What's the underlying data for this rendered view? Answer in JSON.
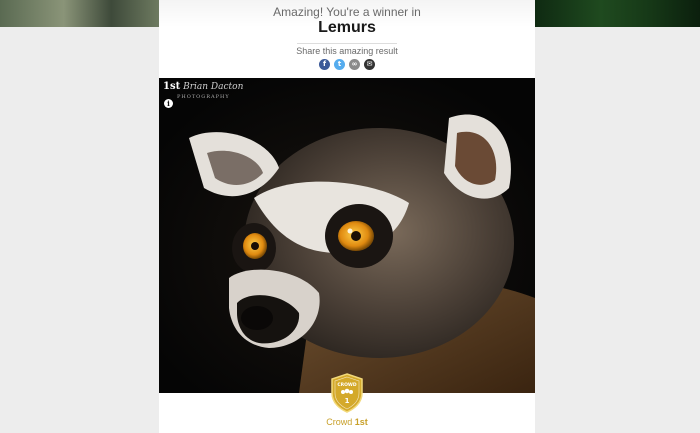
{
  "header": {
    "subtitle": "Amazing! You're a winner in",
    "title": "Lemurs",
    "share_label": "Share this amazing result"
  },
  "share_buttons": [
    {
      "name": "facebook",
      "glyph": "f"
    },
    {
      "name": "twitter",
      "glyph": "t"
    },
    {
      "name": "link",
      "glyph": "∞"
    },
    {
      "name": "email",
      "glyph": "✉"
    }
  ],
  "photo": {
    "watermark_rank": "1st",
    "watermark_name": "Brian Dacton",
    "watermark_sub": "PHOTOGRAPHY",
    "info_glyph": "i"
  },
  "badge": {
    "top_text": "CROWD",
    "number": "1"
  },
  "award": {
    "category": "Crowd",
    "place": "1st"
  },
  "colors": {
    "award_gold": "#c8a02a",
    "facebook": "#3b5998",
    "twitter": "#55acee"
  }
}
